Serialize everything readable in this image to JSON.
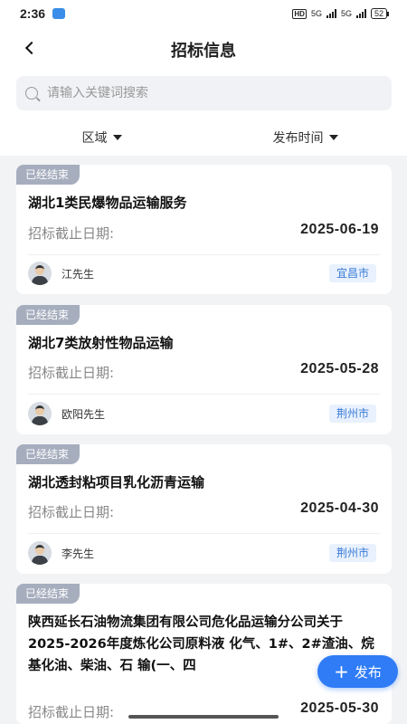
{
  "status": {
    "time": "2:36",
    "hd": "HD",
    "net1": "5G",
    "net2": "5G",
    "battery": "52"
  },
  "header": {
    "title": "招标信息"
  },
  "search": {
    "placeholder": "请输入关键词搜索"
  },
  "filters": [
    {
      "label": "区域"
    },
    {
      "label": "发布时间"
    }
  ],
  "cards": [
    {
      "tag": "已经结束",
      "title": "湖北1类民爆物品运输服务",
      "deadline_label": "招标截止日期:",
      "deadline": "2025-06-19",
      "contact": "江先生",
      "region": "宜昌市"
    },
    {
      "tag": "已经结束",
      "title": "湖北7类放射性物品运输",
      "deadline_label": "招标截止日期:",
      "deadline": "2025-05-28",
      "contact": "欧阳先生",
      "region": "荆州市"
    },
    {
      "tag": "已经结束",
      "title": "湖北透封粘项目乳化沥青运输",
      "deadline_label": "招标截止日期:",
      "deadline": "2025-04-30",
      "contact": "李先生",
      "region": "荆州市"
    },
    {
      "tag": "已经结束",
      "title": "陕西延长石油物流集团有限公司危化品运输分公司关于2025-2026年度炼化公司原料液 化气、1#、2#渣油、烷基化油、柴油、石 输(一、四",
      "deadline_label": "招标截止日期:",
      "deadline": "2025-05-30"
    }
  ],
  "fab": {
    "label": "发布"
  }
}
